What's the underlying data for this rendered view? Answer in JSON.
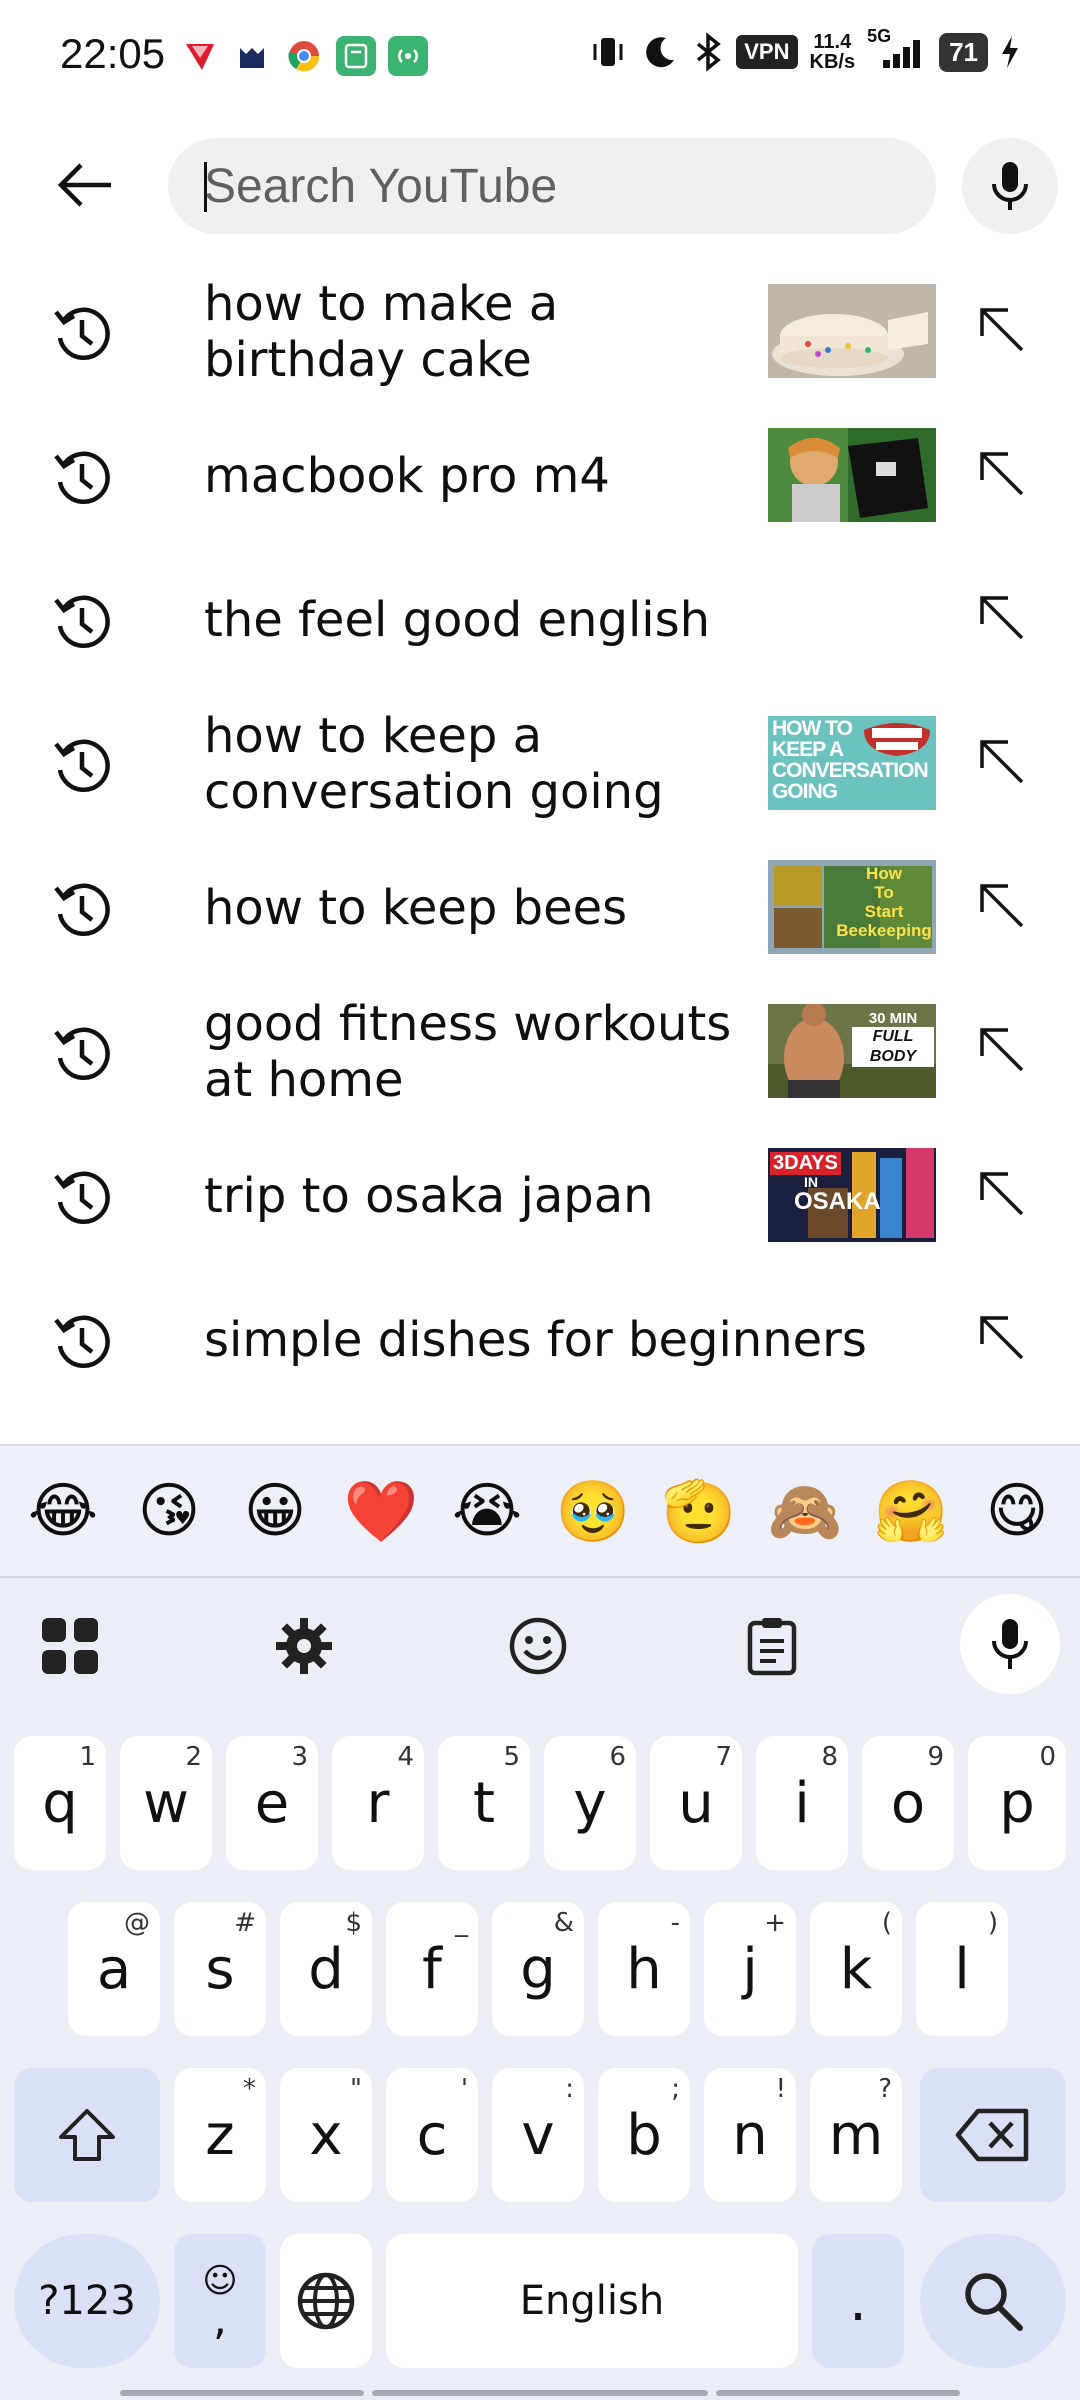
{
  "status_bar": {
    "time": "22:05",
    "vpn": "VPN",
    "speed_value": "11.4",
    "speed_unit": "KB/s",
    "network": "5G",
    "battery": "71"
  },
  "search": {
    "placeholder": "Search YouTube"
  },
  "suggestions": [
    {
      "text": "how to make a birthday cake",
      "thumb": "cake"
    },
    {
      "text": "macbook pro m4",
      "thumb": "macbook"
    },
    {
      "text": "the feel good english",
      "thumb": ""
    },
    {
      "text": "how to keep a conversation going",
      "thumb": "conversation"
    },
    {
      "text": "how to keep bees",
      "thumb": "bees"
    },
    {
      "text": "good fitness workouts at home",
      "thumb": "fitness"
    },
    {
      "text": "trip to osaka japan",
      "thumb": "osaka"
    },
    {
      "text": "simple dishes for beginners",
      "thumb": ""
    }
  ],
  "thumb_text": {
    "conversation": "HOW TO KEEP A CONVERSATION GOING",
    "bees_1": "How",
    "bees_2": "To",
    "bees_3": "Start",
    "bees_4": "Beekeeping",
    "fitness_1": "30 MIN",
    "fitness_2": "FULL BODY",
    "osaka_1": "3DAYS",
    "osaka_2": "IN",
    "osaka_3": "OSAKA"
  },
  "emojis": [
    "😂",
    "😘",
    "😀",
    "❤️",
    "😭",
    "🥹",
    "🫡",
    "🙈",
    "🤗",
    "😋"
  ],
  "keyboard": {
    "row1": [
      {
        "k": "q",
        "h": "1"
      },
      {
        "k": "w",
        "h": "2"
      },
      {
        "k": "e",
        "h": "3"
      },
      {
        "k": "r",
        "h": "4"
      },
      {
        "k": "t",
        "h": "5"
      },
      {
        "k": "y",
        "h": "6"
      },
      {
        "k": "u",
        "h": "7"
      },
      {
        "k": "i",
        "h": "8"
      },
      {
        "k": "o",
        "h": "9"
      },
      {
        "k": "p",
        "h": "0"
      }
    ],
    "row2": [
      {
        "k": "a",
        "h": "@"
      },
      {
        "k": "s",
        "h": "#"
      },
      {
        "k": "d",
        "h": "$"
      },
      {
        "k": "f",
        "h": "_"
      },
      {
        "k": "g",
        "h": "&"
      },
      {
        "k": "h",
        "h": "-"
      },
      {
        "k": "j",
        "h": "+"
      },
      {
        "k": "k",
        "h": "("
      },
      {
        "k": "l",
        "h": ")"
      }
    ],
    "row3": [
      {
        "k": "z",
        "h": "*"
      },
      {
        "k": "x",
        "h": "\""
      },
      {
        "k": "c",
        "h": "'"
      },
      {
        "k": "v",
        "h": ":"
      },
      {
        "k": "b",
        "h": ";"
      },
      {
        "k": "n",
        "h": "!"
      },
      {
        "k": "m",
        "h": "?"
      }
    ],
    "sym_label": "?123",
    "comma": ",",
    "comma_hint": "☺",
    "space_label": "English",
    "period": "."
  },
  "colors": {
    "accent_key": "#dbe0f6",
    "keyboard_bg": "#eceef6"
  }
}
